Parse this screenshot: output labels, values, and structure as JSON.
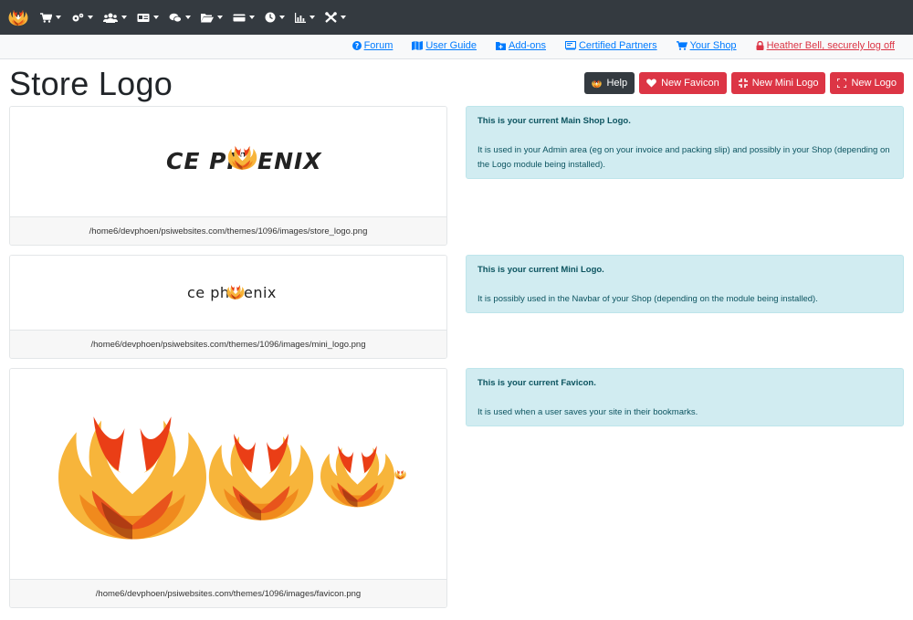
{
  "navbar": {
    "brand_icon": "phoenix-logo-icon",
    "menus": [
      {
        "icon": "cart-icon"
      },
      {
        "icon": "cogs-icon"
      },
      {
        "icon": "users-icon"
      },
      {
        "icon": "id-card-icon"
      },
      {
        "icon": "comments-icon"
      },
      {
        "icon": "folder-open-icon"
      },
      {
        "icon": "credit-card-icon"
      },
      {
        "icon": "clock-icon"
      },
      {
        "icon": "chart-icon"
      },
      {
        "icon": "tools-icon"
      }
    ],
    "bg_color": "#343a40"
  },
  "linkbar": {
    "forum": "Forum",
    "user_guide": "User Guide",
    "addons": "Add-ons",
    "certified_partners": "Certified Partners",
    "your_shop": "Your Shop",
    "logoff": "Heather Bell, securely log off"
  },
  "page": {
    "title": "Store Logo"
  },
  "buttons": {
    "help": "Help",
    "new_favicon": "New Favicon",
    "new_mini_logo": "New Mini Logo",
    "new_logo": "New Logo"
  },
  "cards": {
    "main_logo": {
      "text_left": "CE PH",
      "text_right": "ENIX",
      "path": "/home6/devphoen/psiwebsites.com/themes/1096/images/store_logo.png"
    },
    "mini_logo": {
      "text_left": "ce ph",
      "text_right": "enix",
      "path": "/home6/devphoen/psiwebsites.com/themes/1096/images/mini_logo.png"
    },
    "favicon": {
      "path": "/home6/devphoen/psiwebsites.com/themes/1096/images/favicon.png"
    }
  },
  "alerts": {
    "main_logo": {
      "title": "This is your current Main Shop Logo.",
      "text": "It is used in your Admin area (eg on your invoice and packing slip) and possibly in your Shop (depending on the Logo module being installed)."
    },
    "mini_logo": {
      "title": "This is your current Mini Logo.",
      "text": "It is possibly used in the Navbar of your Shop (depending on the module being installed)."
    },
    "favicon": {
      "title": "This is your current Favicon.",
      "text": "It is used when a user saves your site in their bookmarks."
    }
  },
  "colors": {
    "link": "#007bff",
    "danger": "#dc3545",
    "info_bg": "#d1ecf1",
    "info_text": "#0c5460"
  }
}
